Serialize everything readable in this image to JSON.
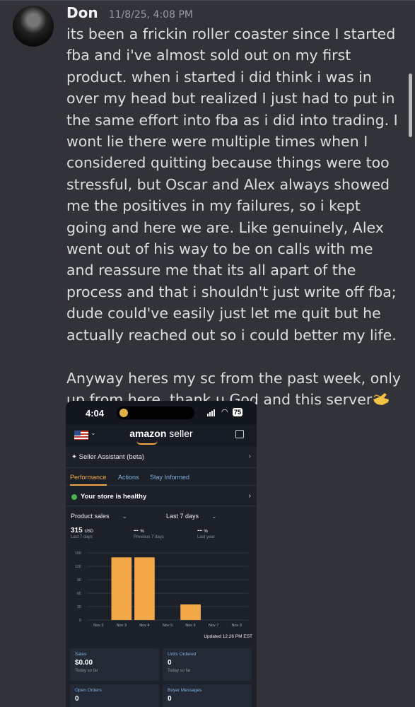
{
  "post": {
    "username": "Don",
    "timestamp": "11/8/25, 4:08 PM",
    "message": "its been a frickin roller coaster since I started fba and i've almost sold out on my first product. when i started i did think i was in over my head but realized I just had to put in the same effort into fba as i did into trading. I wont lie there were multiple times when I considered quitting because things were too stressful, but Oscar and Alex always showed me the positives in my failures, so i kept going and here we are. Like genuinely, Alex went out of his way to be on calls with me and reassure me that its all apart of the process and that i shouldn't just write off fba; dude could've easily just let me quit but he actually reached out so i could better my life.\n\nAnyway heres my sc from the past week, only up from here, thank u God and this server",
    "emoji": "pinching-hand-emoji"
  },
  "screenshot": {
    "status_time": "4:04",
    "battery": "75",
    "brand": "amazon",
    "brand_suffix": " seller",
    "assistant_label": "Seller Assistant (beta)",
    "tabs": [
      "Performance",
      "Actions",
      "Stay Informed"
    ],
    "active_tab": 0,
    "health_status": "Your store is healthy",
    "metric_label": "Product sales",
    "range_label": "Last 7 days",
    "current": {
      "value": "315",
      "unit": "USD",
      "sub": "Last 7 days"
    },
    "previous": {
      "value": "-- ",
      "unit": "%",
      "sub": "Previous 7 days"
    },
    "last_year": {
      "value": "-- ",
      "unit": "%",
      "sub": "Last year"
    },
    "updated": "Updated 12:26 PM EST",
    "cards": [
      {
        "label": "Sales",
        "value": "$0.00",
        "sub": "Today so far"
      },
      {
        "label": "Units Ordered",
        "value": "0",
        "sub": "Today so far"
      },
      {
        "label": "Open Orders",
        "value": "0",
        "sub": ""
      },
      {
        "label": "Buyer Messages",
        "value": "0",
        "sub": ""
      }
    ],
    "colors": {
      "accent": "#f3a847",
      "link": "#7fb1e0",
      "ok": "#4caf50"
    }
  },
  "chart_data": {
    "type": "bar",
    "categories": [
      "Nov 2",
      "Nov 3",
      "Nov 4",
      "Nov 5",
      "Nov 6",
      "Nov 7",
      "Nov 8"
    ],
    "values": [
      0,
      140,
      140,
      0,
      35,
      0,
      0
    ],
    "yticks": [
      "150",
      "120",
      "90",
      "60",
      "30",
      "0"
    ],
    "ylim": [
      0,
      150
    ],
    "grid": true,
    "color": "#f3a847"
  }
}
